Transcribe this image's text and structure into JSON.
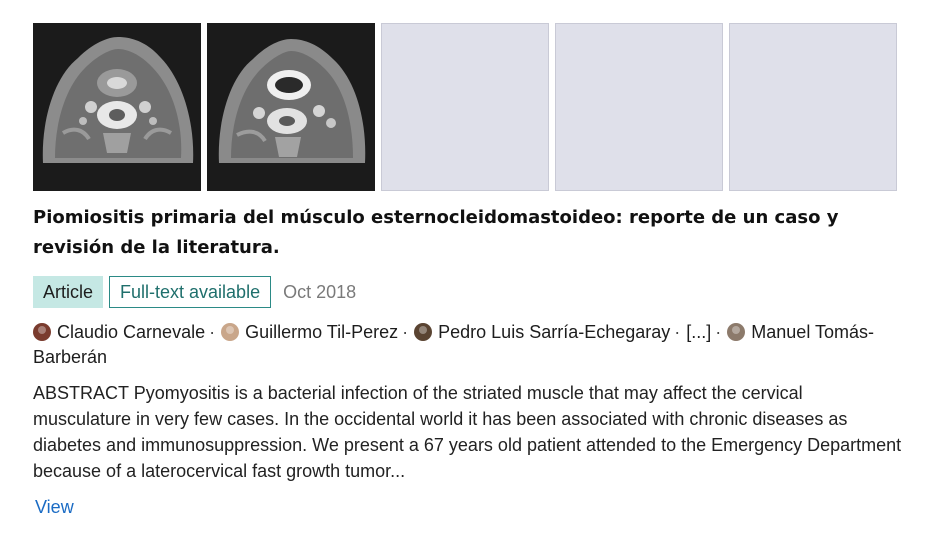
{
  "thumbnails": [
    {
      "kind": "ct-scan",
      "description_icon": "ct-scan-image"
    },
    {
      "kind": "ct-scan",
      "description_icon": "ct-scan-image"
    },
    {
      "kind": "placeholder"
    },
    {
      "kind": "placeholder"
    },
    {
      "kind": "placeholder"
    }
  ],
  "title": "Piomiositis primaria del músculo esternocleidomastoideo: reporte de un caso y revisión de la literatura.",
  "badges": {
    "type": "Article",
    "availability": "Full-text available",
    "date": "Oct 2018"
  },
  "authors": [
    {
      "name": "Claudio Carnevale",
      "avatar_color": "#7a3b2e"
    },
    {
      "name": "Guillermo Til-Perez",
      "avatar_color": "#c9a68a"
    },
    {
      "name": "Pedro Luis Sarría-Echegaray",
      "avatar_color": "#5a4432"
    },
    {
      "name": "[...]"
    },
    {
      "name": "Manuel Tomás-Barberán",
      "avatar_color": "#8c7a6b"
    }
  ],
  "separator": "·",
  "abstract": "ABSTRACT Pyomyositis is a bacterial infection of the striated muscle that may affect the cervical musculature in very few cases. In the occidental world it has been associated with chronic diseases as diabetes and immunosuppression. We present a 67 years old patient attended to the Emergency Department because of a laterocervical fast growth tumor...",
  "view_label": "View",
  "colors": {
    "badge_bg": "#c5e8e4",
    "badge_border": "#2b8a86",
    "link": "#1a6bc4",
    "placeholder": "#dfe0ea"
  }
}
